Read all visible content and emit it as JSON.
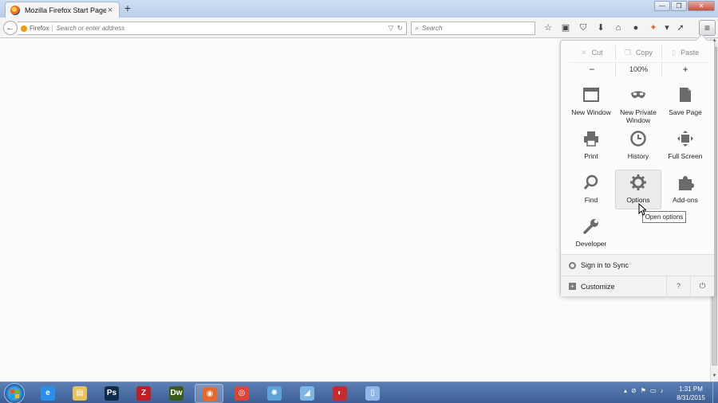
{
  "browser": {
    "tab_title": "Mozilla Firefox Start Page",
    "tab_close": "×",
    "new_tab": "+",
    "window_controls": [
      "—",
      "❐",
      "✕"
    ]
  },
  "navbar": {
    "back": "←",
    "identity_label": "Firefox",
    "url_placeholder": "Search or enter address",
    "dropdown": "▽",
    "reload": "↻",
    "search_icon": "⌕",
    "search_placeholder": "Search",
    "toolbar_icons": [
      {
        "name": "bookmark-star-icon",
        "glyph": "☆"
      },
      {
        "name": "clipboard-icon",
        "glyph": "▣"
      },
      {
        "name": "pocket-icon",
        "glyph": "⛉"
      },
      {
        "name": "download-icon",
        "glyph": "⬇"
      },
      {
        "name": "home-icon",
        "glyph": "⌂"
      },
      {
        "name": "chat-icon",
        "glyph": "●"
      },
      {
        "name": "extension-icon",
        "glyph": "✦"
      },
      {
        "name": "extension-dropdown-icon",
        "glyph": "▾"
      },
      {
        "name": "extension2-icon",
        "glyph": "➚"
      }
    ],
    "menu_glyph": "≡"
  },
  "panel": {
    "edit": {
      "cut": "Cut",
      "copy": "Copy",
      "paste": "Paste",
      "cut_icon": "✕",
      "copy_icon": "❐",
      "paste_icon": "▯"
    },
    "zoom": {
      "out": "−",
      "level": "100%",
      "in": "+"
    },
    "items": [
      {
        "name": "new-window",
        "label": "New Window"
      },
      {
        "name": "new-private-window",
        "label": "New Private Window"
      },
      {
        "name": "save-page",
        "label": "Save Page"
      },
      {
        "name": "print",
        "label": "Print"
      },
      {
        "name": "history",
        "label": "History"
      },
      {
        "name": "full-screen",
        "label": "Full Screen"
      },
      {
        "name": "find",
        "label": "Find"
      },
      {
        "name": "options",
        "label": "Options"
      },
      {
        "name": "add-ons",
        "label": "Add-ons"
      },
      {
        "name": "developer",
        "label": "Developer"
      }
    ],
    "sync_label": "Sign in to Sync",
    "customize_label": "Customize",
    "customize_icon": "+",
    "help": "?",
    "quit": "⏻"
  },
  "tooltip": "Open options",
  "taskbar": {
    "apps": [
      {
        "name": "internet-explorer",
        "glyph": "e",
        "color": "#2b8ee8"
      },
      {
        "name": "file-explorer",
        "glyph": "▤",
        "color": "#e9c25a"
      },
      {
        "name": "photoshop",
        "glyph": "Ps",
        "color": "#0d2a4a"
      },
      {
        "name": "filezilla",
        "glyph": "Z",
        "color": "#bf1e22"
      },
      {
        "name": "dreamweaver",
        "glyph": "Dw",
        "color": "#3b5b1e"
      },
      {
        "name": "firefox",
        "glyph": "◉",
        "color": "#e8672a"
      },
      {
        "name": "chrome",
        "glyph": "◎",
        "color": "#db4437"
      },
      {
        "name": "safari",
        "glyph": "✺",
        "color": "#5aa2d8"
      },
      {
        "name": "paper-tool",
        "glyph": "◢",
        "color": "#7fb6e6"
      },
      {
        "name": "app-circle",
        "glyph": "◐",
        "color": "#c62b2b"
      },
      {
        "name": "document",
        "glyph": "▯",
        "color": "#8fb8e8"
      }
    ],
    "tray_icons": [
      "▴",
      "⊘",
      "⚑",
      "▭",
      "♪"
    ],
    "time": "1:31 PM",
    "date": "8/31/2015"
  },
  "colors": {
    "accent": "#f39c12",
    "panel_hover": "#ececec",
    "taskbar": "#4a6da3"
  }
}
